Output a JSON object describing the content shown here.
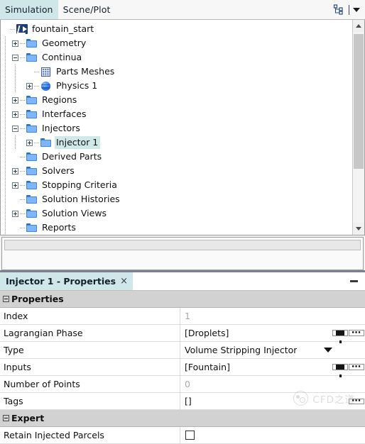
{
  "tabbar": {
    "tabs": [
      {
        "label": "Simulation",
        "active": true
      },
      {
        "label": "Scene/Plot",
        "active": false
      }
    ],
    "tree_layout_icon": "tree-hierarchy-icon",
    "dropdown_icon": "chevron-down-icon"
  },
  "tree": {
    "scroll": {
      "up_icon": "chevron-up-icon",
      "down_icon": "chevron-down-icon"
    },
    "nodes": [
      {
        "label": "fountain_start",
        "depth": 0,
        "icon": "simulation-file-icon",
        "expander": "none",
        "selected": false
      },
      {
        "label": "Geometry",
        "depth": 1,
        "icon": "folder-icon",
        "expander": "plus",
        "selected": false
      },
      {
        "label": "Continua",
        "depth": 1,
        "icon": "folder-icon",
        "expander": "minus",
        "selected": false
      },
      {
        "label": "Parts Meshes",
        "depth": 2,
        "icon": "mesh-grid-icon",
        "expander": "none",
        "selected": false
      },
      {
        "label": "Physics 1",
        "depth": 2,
        "icon": "physics-sphere-icon",
        "expander": "plus",
        "selected": false
      },
      {
        "label": "Regions",
        "depth": 1,
        "icon": "folder-icon",
        "expander": "plus",
        "selected": false
      },
      {
        "label": "Interfaces",
        "depth": 1,
        "icon": "folder-icon",
        "expander": "plus",
        "selected": false
      },
      {
        "label": "Injectors",
        "depth": 1,
        "icon": "folder-icon",
        "expander": "minus",
        "selected": false
      },
      {
        "label": "Injector 1",
        "depth": 2,
        "icon": "folder-icon",
        "expander": "plus",
        "selected": true
      },
      {
        "label": "Derived Parts",
        "depth": 1,
        "icon": "folder-icon",
        "expander": "none",
        "selected": false
      },
      {
        "label": "Solvers",
        "depth": 1,
        "icon": "folder-icon",
        "expander": "plus",
        "selected": false
      },
      {
        "label": "Stopping Criteria",
        "depth": 1,
        "icon": "folder-icon",
        "expander": "plus",
        "selected": false
      },
      {
        "label": "Solution Histories",
        "depth": 1,
        "icon": "folder-icon",
        "expander": "none",
        "selected": false
      },
      {
        "label": "Solution Views",
        "depth": 1,
        "icon": "folder-icon",
        "expander": "plus",
        "selected": false
      },
      {
        "label": "Reports",
        "depth": 1,
        "icon": "folder-icon",
        "expander": "none",
        "selected": false
      }
    ]
  },
  "properties_panel": {
    "tab_title": "Injector 1 - Properties",
    "close_glyph": "×",
    "minimize_icon": "minimize-icon",
    "rows": [
      {
        "kind": "section",
        "name": "Properties"
      },
      {
        "kind": "prop",
        "name": "Index",
        "value": "1",
        "muted": true,
        "controls": []
      },
      {
        "kind": "prop",
        "name": "Lagrangian Phase",
        "value": "[Droplets]",
        "muted": false,
        "controls": [
          "filter",
          "ellipsis"
        ]
      },
      {
        "kind": "prop",
        "name": "Type",
        "value": "Volume Stripping Injector",
        "muted": false,
        "controls": [
          "dropdown"
        ]
      },
      {
        "kind": "prop",
        "name": "Inputs",
        "value": "[Fountain]",
        "muted": false,
        "controls": [
          "filter",
          "ellipsis"
        ]
      },
      {
        "kind": "prop",
        "name": "Number of Points",
        "value": "0",
        "muted": true,
        "controls": []
      },
      {
        "kind": "prop",
        "name": "Tags",
        "value": "[]",
        "muted": false,
        "controls": [
          "ellipsis"
        ]
      },
      {
        "kind": "section",
        "name": "Expert"
      },
      {
        "kind": "prop",
        "name": "Retain Injected Parcels",
        "value": "",
        "muted": false,
        "controls": [
          "checkbox"
        ],
        "checked": false
      }
    ]
  },
  "watermark": {
    "text": "CFD之道",
    "logo_icon": "cfd-logo-icon"
  },
  "colors": {
    "tab_active_bg": "#cfe7e8",
    "selection_bg": "#cfe8e8",
    "section_bg": "#d2d2d2",
    "folder_blue": "#3b86f0",
    "muted_text": "#a8a8a8",
    "panel_divider": "#7d7f92"
  }
}
